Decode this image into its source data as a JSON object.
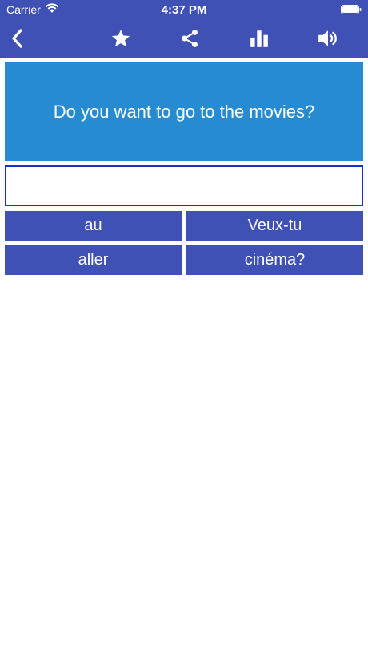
{
  "status_bar": {
    "carrier": "Carrier",
    "time": "4:37 PM"
  },
  "nav": {
    "icons": [
      "back-chevron-icon",
      "star-icon",
      "share-icon",
      "bar-chart-icon",
      "speaker-icon"
    ]
  },
  "question": {
    "text": "Do you want to go to the movies?"
  },
  "answer": {
    "value": ""
  },
  "word_options": [
    "au",
    "Veux-tu",
    "aller",
    "cinéma?"
  ],
  "colors": {
    "bar": "#3f51b5",
    "question_bg": "#268bd0",
    "answer_border": "#1f2ec4",
    "word_bg": "#3f51b5"
  }
}
